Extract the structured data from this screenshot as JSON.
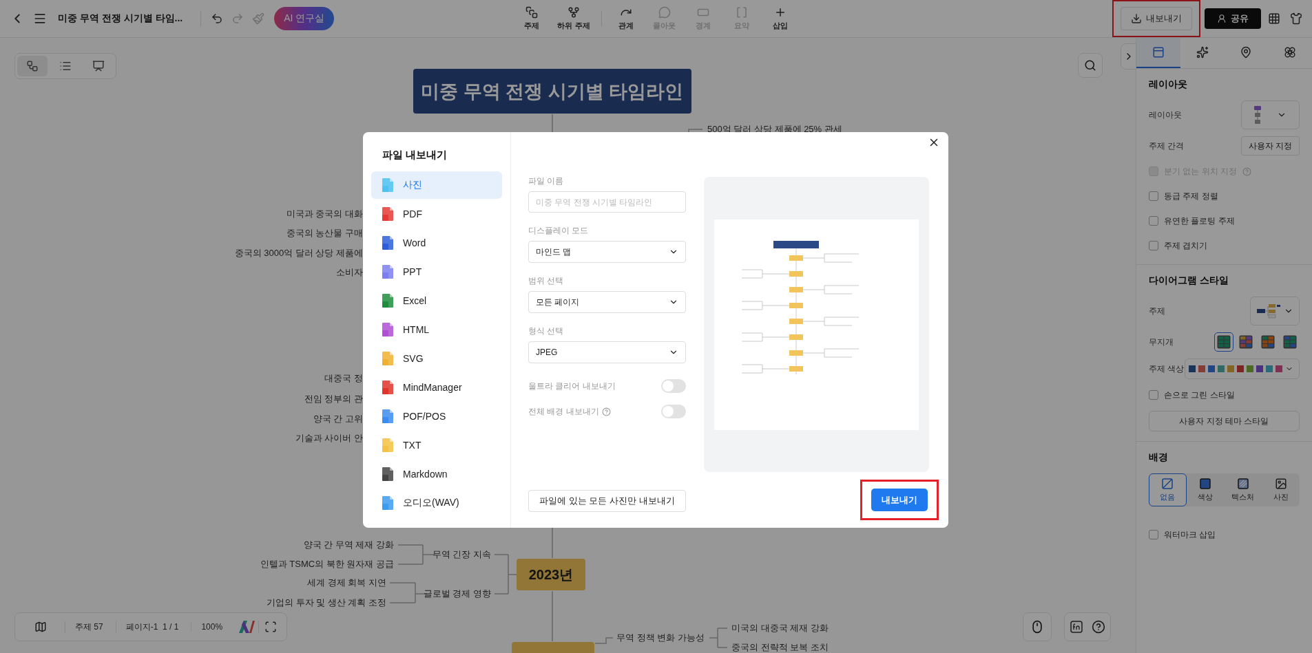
{
  "toolbar": {
    "title": "미중 무역 전쟁 시기별 타임...",
    "redo_disabled": true,
    "ai_button": "AI 연구실",
    "tools": [
      {
        "label": "주제",
        "disabled": false
      },
      {
        "label": "하위 주제",
        "disabled": false
      },
      {
        "label": "관계",
        "disabled": false
      },
      {
        "label": "콜아웃",
        "disabled": true
      },
      {
        "label": "경계",
        "disabled": true
      },
      {
        "label": "요약",
        "disabled": true
      },
      {
        "label": "삽입",
        "disabled": false
      }
    ],
    "export_button": {
      "label": "내보내기",
      "highlighted": true
    },
    "share_button": "공유"
  },
  "view_switcher": [
    {
      "selected": true
    },
    {
      "selected": false
    },
    {
      "selected": false
    }
  ],
  "mind_map": {
    "root": "미중 무역 전쟁 시기별 타임라인",
    "top_note": "500억 달러 상당 제품에 25% 관세",
    "hidden_left": [
      "미국과 중국의 대화",
      "중국의 농산물 구매",
      "중국의 3000억 달러 상당 제품에",
      "소비자",
      "대중국 정",
      "전임 정부의 관",
      "양국 간 고위",
      "기술과 사이버 안"
    ],
    "year_node": "2023년",
    "year_branches": [
      {
        "label": "무역 긴장 지속",
        "children": [
          "양국 간 무역 제재 강화",
          "인텔과 TSMC의 북한 원자재 공급"
        ]
      },
      {
        "label": "글로벌 경제 영향",
        "children": [
          "세계 경제 회복 지연",
          "기업의 투자 및 생산 계획 조정"
        ]
      }
    ],
    "next_branch": {
      "label": "무역 정책 변화 가능성",
      "children": [
        "미국의 대중국 제재 강화",
        "중국의 전략적 보복 조치"
      ]
    }
  },
  "status_bar": {
    "topics": "주제 57",
    "page": "페이지-1  1 / 1",
    "zoom": "100%"
  },
  "panel": {
    "tabs": [
      {
        "selected": true
      },
      {
        "selected": false
      },
      {
        "selected": false
      },
      {
        "selected": false
      }
    ],
    "layout_section": {
      "title": "레이아웃",
      "layout_label": "레이아웃",
      "spacing_label": "주제 간격",
      "spacing_button": "사용자 지정",
      "options": [
        {
          "label": "분기 없는 위치 지정",
          "checked": false,
          "disabled": true,
          "help": true
        },
        {
          "label": "동급 주제 정렬",
          "checked": false,
          "disabled": false,
          "help": false
        },
        {
          "label": "유연한 플로팅 주제",
          "checked": false,
          "disabled": false,
          "help": false
        },
        {
          "label": "주제 겹치기",
          "checked": false,
          "disabled": false,
          "help": false
        }
      ]
    },
    "style_section": {
      "title": "다이어그램 스타일",
      "topic_label": "주제",
      "rainbow_label": "무지개",
      "rainbow": [
        {
          "selected": true
        },
        {
          "selected": false
        },
        {
          "selected": false
        },
        {
          "selected": false
        }
      ],
      "color_label": "주제 색상",
      "hand_drawn": {
        "label": "손으로 그린 스타일",
        "checked": false
      },
      "custom_theme_button": "사용자 지정 테마 스타일"
    },
    "background_section": {
      "title": "배경",
      "options": [
        {
          "label": "없음",
          "selected": true
        },
        {
          "label": "색상",
          "selected": false
        },
        {
          "label": "텍스처",
          "selected": false
        },
        {
          "label": "사진",
          "selected": false
        }
      ],
      "watermark": {
        "label": "워터마크 삽입",
        "checked": false
      }
    }
  },
  "export_dialog": {
    "title": "파일 내보내기",
    "formats": [
      {
        "label": "사진",
        "selected": true
      },
      {
        "label": "PDF",
        "selected": false
      },
      {
        "label": "Word",
        "selected": false
      },
      {
        "label": "PPT",
        "selected": false
      },
      {
        "label": "Excel",
        "selected": false
      },
      {
        "label": "HTML",
        "selected": false
      },
      {
        "label": "SVG",
        "selected": false
      },
      {
        "label": "MindManager",
        "selected": false
      },
      {
        "label": "POF/POS",
        "selected": false
      },
      {
        "label": "TXT",
        "selected": false
      },
      {
        "label": "Markdown",
        "selected": false
      },
      {
        "label": "오디오(WAV)",
        "selected": false
      }
    ],
    "file_name": {
      "label": "파일 이름",
      "placeholder": "미중 무역 전쟁 시기별 타임라인"
    },
    "selects": [
      {
        "label": "디스플레이 모드",
        "value": "마인드 맵"
      },
      {
        "label": "범위 선택",
        "value": "모든 페이지"
      },
      {
        "label": "형식 선택",
        "value": "JPEG"
      }
    ],
    "toggles": [
      {
        "label": "울트라 클리어 내보내기",
        "on": false,
        "help": false
      },
      {
        "label": "전체 배경 내보내기",
        "on": false,
        "help": true
      }
    ],
    "images_only_button": "파일에 있는 모든 사진만 내보내기",
    "export_button": {
      "label": "내보내기",
      "highlighted": true
    }
  }
}
